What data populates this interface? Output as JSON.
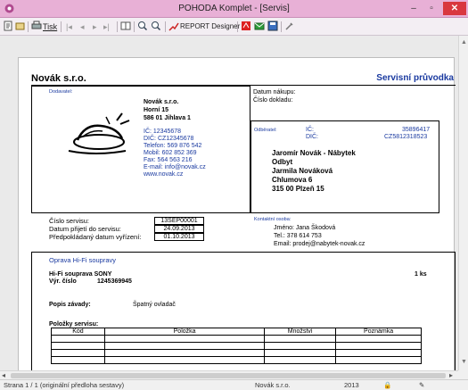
{
  "window": {
    "title": "POHODA Komplet - [Servis]"
  },
  "toolbar": {
    "print_label": "Tisk",
    "report_designer_label": "REPORT Designer"
  },
  "document": {
    "company_heading": "Novák s.r.o.",
    "doc_title": "Servisní průvodka",
    "supplier": {
      "label": "Dodavatel:",
      "name": "Novák s.r.o.",
      "street": "Horní 15",
      "city": "586 01 Jihlava 1",
      "ic": "IČ: 12345678",
      "dic": "DIČ: CZ12345678",
      "phone": "Telefon: 569 876 542",
      "mobile": "Mobil: 602 852 369",
      "fax": "Fax: 564 563 216",
      "email": "E-mail: info@novak.cz",
      "web": "www.novak.cz"
    },
    "purchase_date_label": "Datum nákupu:",
    "receipt_no_label": "Číslo dokladu:",
    "customer": {
      "label": "Odběratel:",
      "ic_label": "IČ:",
      "ic": "35896417",
      "dic_label": "DIČ:",
      "dic": "CZ5812318523",
      "name": "Jaromír Novák - Nábytek",
      "dept": "Odbyt",
      "person": "Jarmila Nováková",
      "street": "Chlumova 6",
      "city": "315 00 Plzeň 15"
    },
    "service": {
      "number_label": "Číslo servisu:",
      "number": "13SEP00001",
      "received_label": "Datum přijetí do servisu:",
      "received": "24.09.2013",
      "expected_label": "Předpokládaný datum vyřízení:",
      "expected": "01.10.2013"
    },
    "contact": {
      "label": "Kontaktní osoba:",
      "name": "Jméno: Jana Škodová",
      "phone": "Tel.:    378 614 753",
      "email": "Email:  prodej@nabytek-novak.cz"
    },
    "repair_title": "Oprava Hi-Fi soupravy",
    "item_name": "Hi-Fi souprava SONY",
    "serial_label": "Výr. číslo",
    "serial": "1245369945",
    "quantity": "1 ks",
    "defect_label": "Popis závady:",
    "defect": "Špatný ovladač",
    "items_label": "Položky servisu:",
    "columns": [
      "Kód",
      "Položka",
      "Množství",
      "Poznámka"
    ]
  },
  "status": {
    "page": "Strana 1 / 1  (originální předloha sestavy)",
    "company": "Novák s.r.o.",
    "year": "2013"
  }
}
